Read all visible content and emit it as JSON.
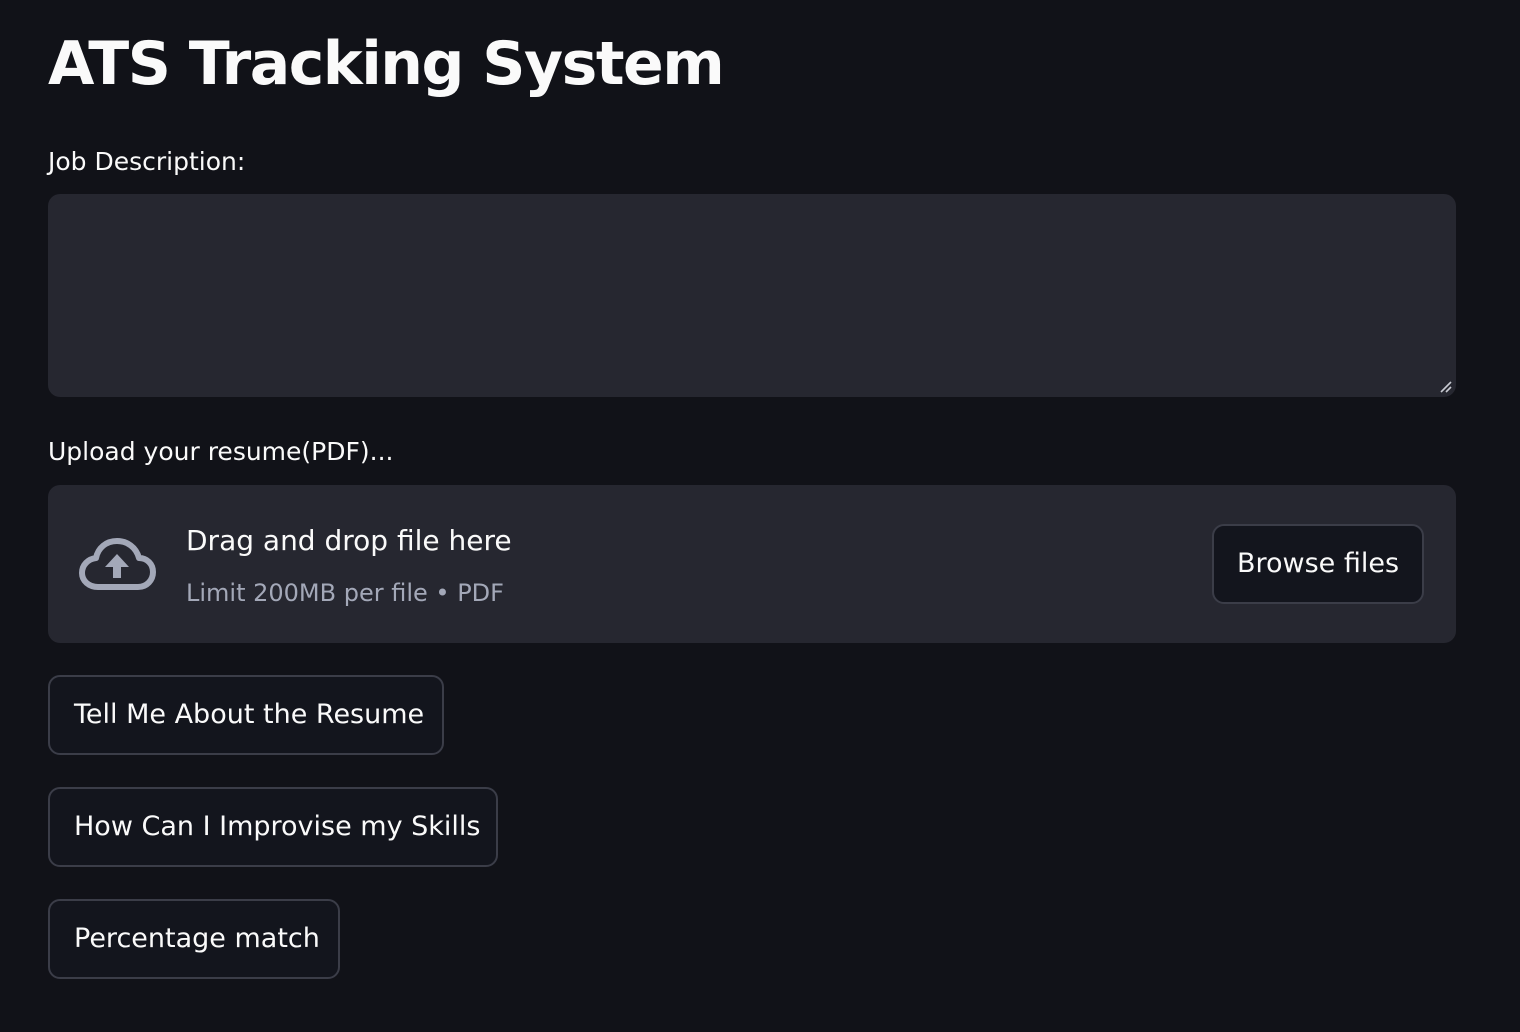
{
  "page": {
    "title": "ATS Tracking System"
  },
  "job_description": {
    "label": "Job Description:",
    "value": ""
  },
  "uploader": {
    "label": "Upload your resume(PDF)...",
    "drop_text": "Drag and drop file here",
    "limit_text": "Limit 200MB per file • PDF",
    "browse_label": "Browse files",
    "icon": "cloud-upload-icon"
  },
  "actions": {
    "tell_label": "Tell Me About the Resume",
    "improve_label": "How Can I Improvise my Skills",
    "percent_label": "Percentage match"
  },
  "theme": {
    "background": "#111218",
    "surface": "#262730",
    "text": "#fafafa",
    "muted_text": "#a3a8b8",
    "button_border": "#3b3d48"
  }
}
